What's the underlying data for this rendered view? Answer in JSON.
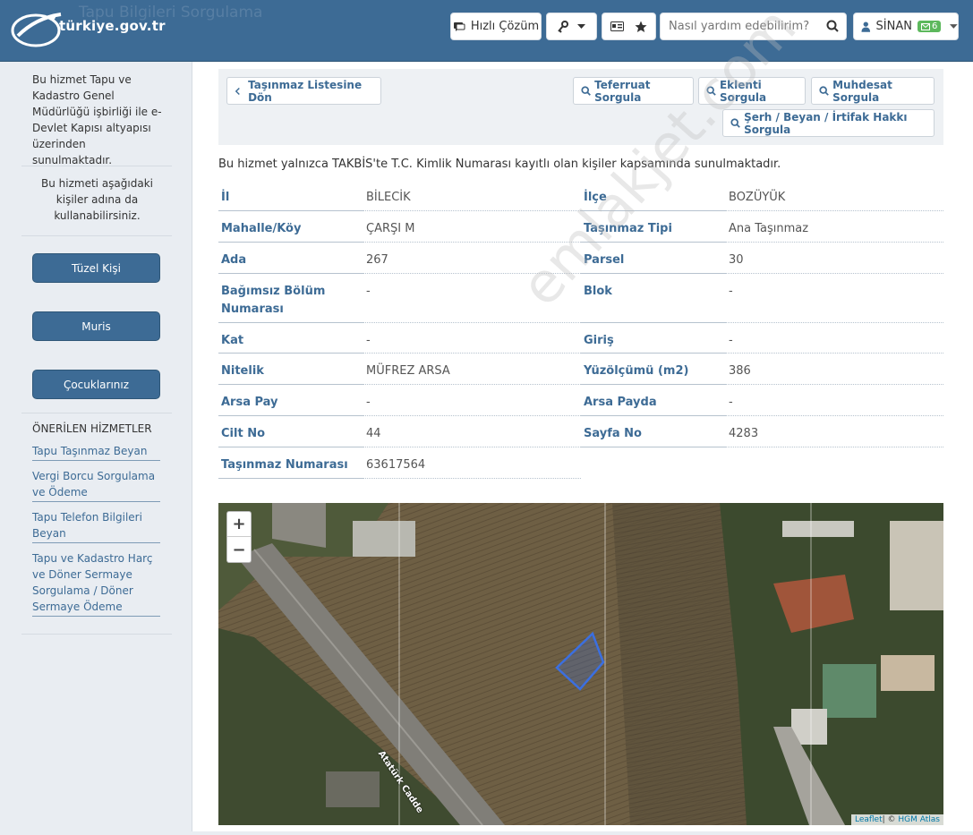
{
  "header": {
    "logo_text": "türkiye.gov.tr",
    "page_title": "Tapu Bilgileri Sorgulama",
    "quick_solution_label": "Hızlı Çözüm",
    "search_placeholder": "Nasıl yardım edebilirim?",
    "user_name": "SİNAN",
    "message_count": "6"
  },
  "sidebar": {
    "intro": "Bu hizmet Tapu ve Kadastro Genel Müdürlüğü işbirliği ile e-Devlet Kapısı altyapısı üzerinden sunulmaktadır.",
    "on_behalf": "Bu hizmeti aşağıdaki kişiler adına da kullanabilirsiniz.",
    "buttons": [
      "Tüzel Kişi",
      "Muris",
      "Çocuklarınız"
    ],
    "recommended_title": "ÖNERİLEN HİZMETLER",
    "recommended": [
      "Tapu Taşınmaz Beyan",
      "Vergi Borcu Sorgulama ve Ödeme",
      "Tapu Telefon Bilgileri Beyan",
      "Tapu ve Kadastro Harç ve Döner Sermaye Sorgulama / Döner Sermaye Ödeme"
    ]
  },
  "toolbar": {
    "back": "Taşınmaz Listesine Dön",
    "detail": "Teferruat Sorgula",
    "annex": "Eklenti Sorgula",
    "muhdesat": "Muhdesat Sorgula",
    "serh": "Şerh / Beyan / İrtifak Hakkı Sorgula"
  },
  "info_text": "Bu hizmet yalnızca TAKBİS'te T.C. Kimlik Numarası kayıtlı olan kişiler kapsamında sunulmaktadır.",
  "fields": {
    "il_label": "İl",
    "il": "BİLECİK",
    "ilce_label": "İlçe",
    "ilce": "BOZÜYÜK",
    "mahalle_label": "Mahalle/Köy",
    "mahalle": "ÇARŞI M",
    "tip_label": "Taşınmaz Tipi",
    "tip": "Ana Taşınmaz",
    "ada_label": "Ada",
    "ada": "267",
    "parsel_label": "Parsel",
    "parsel": "30",
    "bolum_label_1": "Bağımsız Bölüm",
    "bolum_label_2": "Numarası",
    "bolum": "-",
    "blok_label": "Blok",
    "blok": "-",
    "kat_label": "Kat",
    "kat": "-",
    "giris_label": "Giriş",
    "giris": "-",
    "nitelik_label": "Nitelik",
    "nitelik": "MÜFREZ ARSA",
    "yuzolcumu_label": "Yüzölçümü (m2)",
    "yuzolcumu": "386",
    "arsapay_label": "Arsa Pay",
    "arsapay": "-",
    "arsapayda_label": "Arsa Payda",
    "arsapayda": "-",
    "cilt_label": "Cilt No",
    "cilt": "44",
    "sayfa_label": "Sayfa No",
    "sayfa": "4283",
    "numara_label": "Taşınmaz Numarası",
    "numara": "63617564"
  },
  "map": {
    "zoom_in": "+",
    "zoom_out": "−",
    "road_label": "Atatürk Cadde",
    "attribution_leaflet": "Leaflet",
    "attribution_rest": "| © ",
    "attribution_hgm": "HGM Atlas"
  },
  "watermark": "emlakjet.com",
  "colors": {
    "brand": "#3d6b95",
    "accent_green": "#5cb85c",
    "parcel": "#3b6fe0"
  }
}
